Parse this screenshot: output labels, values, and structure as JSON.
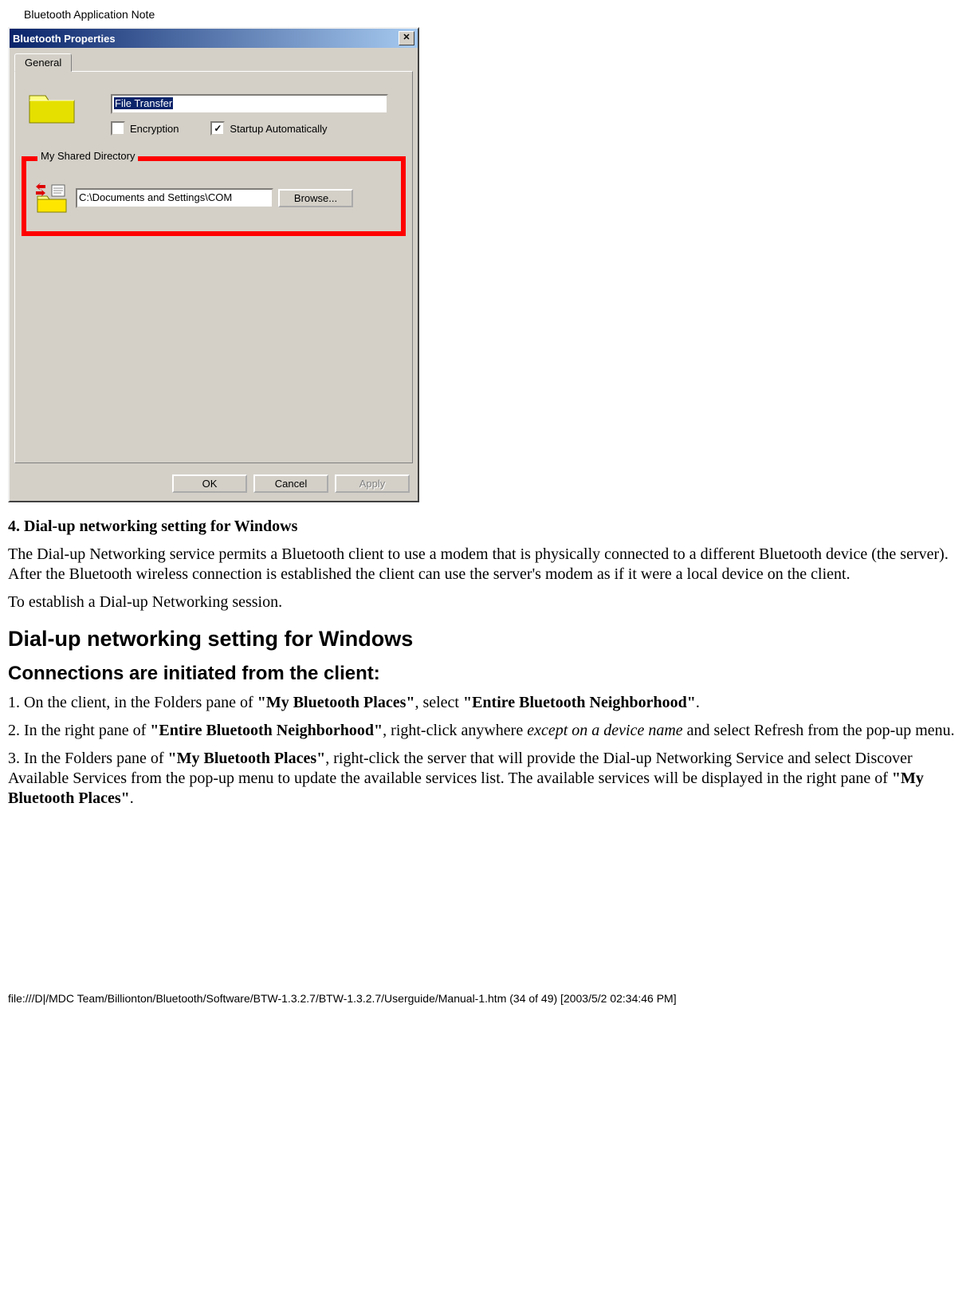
{
  "page_header": "Bluetooth Application Note",
  "dialog": {
    "title": "Bluetooth Properties",
    "close_glyph": "✕",
    "tab_general": "General",
    "file_transfer_value": "File Transfer",
    "encryption_label": "Encryption",
    "encryption_checked": "",
    "startup_label": "Startup Automatically",
    "startup_checked": "✓",
    "fieldset_legend": "My Shared Directory",
    "path_value": "C:\\Documents and Settings\\COM",
    "browse_label": "Browse...",
    "ok_label": "OK",
    "cancel_label": "Cancel",
    "apply_label": "Apply"
  },
  "content": {
    "section_title": "4. Dial-up networking setting for Windows",
    "para1": "The Dial-up Networking service permits a Bluetooth client to use a modem that is physically connected to a different Bluetooth device (the server). After the Bluetooth wireless connection is established the client can use the server's modem as if it were a local device on the client.",
    "para2": "To establish a Dial-up Networking session.",
    "h2": "Dial-up networking setting for Windows",
    "h3": "Connections are initiated from the client:",
    "step1_a": "1. On the client, in the Folders pane of ",
    "step1_b": "\"My Bluetooth Places\"",
    "step1_c": ", select ",
    "step1_d": "\"Entire Bluetooth Neighborhood\"",
    "step1_e": ".",
    "step2_a": "2. In the right pane of ",
    "step2_b": "\"Entire Bluetooth Neighborhood\"",
    "step2_c": ", right-click anywhere ",
    "step2_d": "except on a device name",
    "step2_e": " and select Refresh from the pop-up menu.",
    "step3_a": "3. In the Folders pane of ",
    "step3_b": "\"My Bluetooth Places\"",
    "step3_c": ", right-click the server that will provide the Dial-up Networking Service and select Discover Available Services from the pop-up menu to update the available services list. The available services will be displayed in the right pane of ",
    "step3_d": "\"My Bluetooth Places\"",
    "step3_e": "."
  },
  "footer": "file:///D|/MDC Team/Billionton/Bluetooth/Software/BTW-1.3.2.7/BTW-1.3.2.7/Userguide/Manual-1.htm (34 of 49) [2003/5/2 02:34:46 PM]"
}
